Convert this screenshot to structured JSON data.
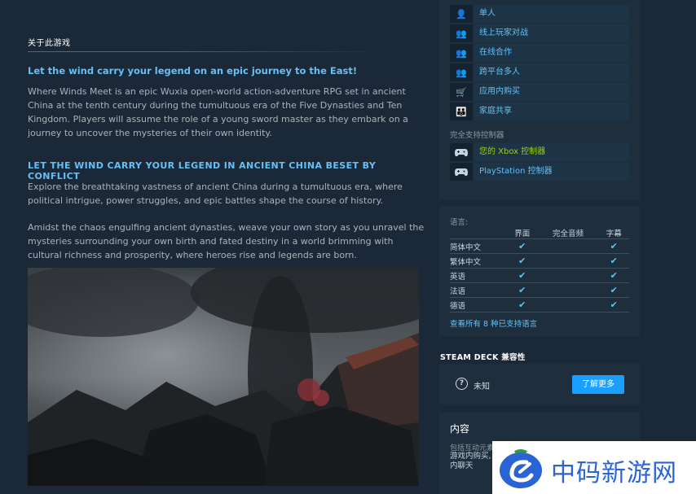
{
  "about": {
    "title": "关于此游戏",
    "heading1": "Let the wind carry your legend on an epic journey to the East!",
    "para1": "Where Winds Meet is an epic Wuxia open-world action-adventure RPG set in ancient China at the tenth century during the tumultuous era of the Five Dynasties and Ten Kingdom. Players will assume the role of a young sword master as they embark on a journey to uncover the mysteries of their own identity.",
    "heading2": "LET THE WIND CARRY YOUR LEGEND IN ANCIENT CHINA BESET BY CONFLICT",
    "para2": "Explore the breathtaking vastness of ancient China during a tumultuous era, where political intrigue, power struggles, and epic battles shape the course of history.",
    "para3": "Amidst the chaos engulfing ancient dynasties, weave your own story as you unravel the mysteries surrounding your own birth and fated destiny in a world brimming with cultural richness and prosperity, where heroes rise and legends are born."
  },
  "features": {
    "items": [
      {
        "icon": "single-player-icon",
        "glyph": "👤",
        "label": "单人"
      },
      {
        "icon": "online-pvp-icon",
        "glyph": "👥",
        "label": "线上玩家对战"
      },
      {
        "icon": "online-coop-icon",
        "glyph": "👥",
        "label": "在线合作"
      },
      {
        "icon": "cross-platform-icon",
        "glyph": "👥",
        "label": "跨平台多人"
      },
      {
        "icon": "cart-icon",
        "glyph": "🛒",
        "label": "应用内购买"
      },
      {
        "icon": "family-sharing-icon",
        "glyph": "👪",
        "label": "家庭共享"
      }
    ],
    "controller_title": "完全支持控制器",
    "controllers": [
      {
        "icon": "xbox-gamepad-icon",
        "label": "您的 Xbox 控制器"
      },
      {
        "icon": "playstation-gamepad-icon",
        "label": "PlayStation 控制器"
      }
    ]
  },
  "languages": {
    "label": "语言:",
    "headers": [
      "",
      "界面",
      "完全音频",
      "字幕"
    ],
    "rows": [
      {
        "name": "简体中文",
        "ui": "✔",
        "audio": "",
        "subs": "✔"
      },
      {
        "name": "繁体中文",
        "ui": "✔",
        "audio": "",
        "subs": "✔"
      },
      {
        "name": "英语",
        "ui": "✔",
        "audio": "",
        "subs": "✔"
      },
      {
        "name": "法语",
        "ui": "✔",
        "audio": "",
        "subs": "✔"
      },
      {
        "name": "德语",
        "ui": "✔",
        "audio": "",
        "subs": "✔"
      }
    ],
    "see_all": "查看所有 8 种已支持语言"
  },
  "deck": {
    "title": "STEAM DECK 兼容性",
    "status_icon": "?",
    "status": "未知",
    "button": "了解更多"
  },
  "content": {
    "title": "内容",
    "sub": "包括互动元素",
    "text": "游戏内购买, 内聊天"
  },
  "watermark": {
    "text": "中码新游网"
  },
  "colors": {
    "background": "#1b2838",
    "link": "#66c0f4",
    "green": "#a4d007",
    "button": "#1a9fff"
  }
}
